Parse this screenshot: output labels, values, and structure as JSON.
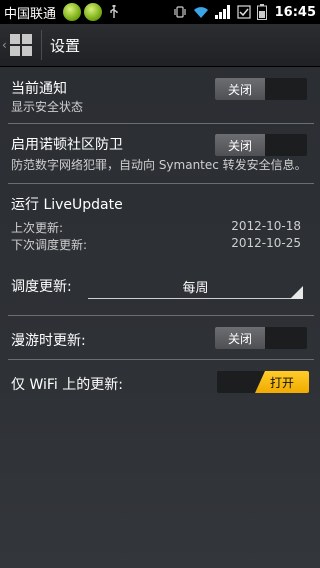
{
  "status_bar": {
    "carrier": "中国联通",
    "time": "16:45"
  },
  "action_bar": {
    "title": "设置"
  },
  "settings": {
    "notification": {
      "title": "当前通知",
      "subtitle": "显示安全状态",
      "toggle_label": "关闭",
      "state": "off"
    },
    "community_guard": {
      "title": "启用诺顿社区防卫",
      "subtitle": "防范数字网络犯罪，自动向 Symantec 转发安全信息。",
      "toggle_label": "关闭",
      "state": "off"
    },
    "liveupdate": {
      "title": "运行 LiveUpdate",
      "last_update_label": "上次更新:",
      "last_update_value": "2012-10-18",
      "next_update_label": "下次调度更新:",
      "next_update_value": "2012-10-25"
    },
    "schedule": {
      "label": "调度更新:",
      "value": "每周"
    },
    "roaming": {
      "title": "漫游时更新:",
      "toggle_label": "关闭",
      "state": "off"
    },
    "wifi_only": {
      "title": "仅 WiFi 上的更新:",
      "toggle_label": "打开",
      "state": "on"
    }
  }
}
